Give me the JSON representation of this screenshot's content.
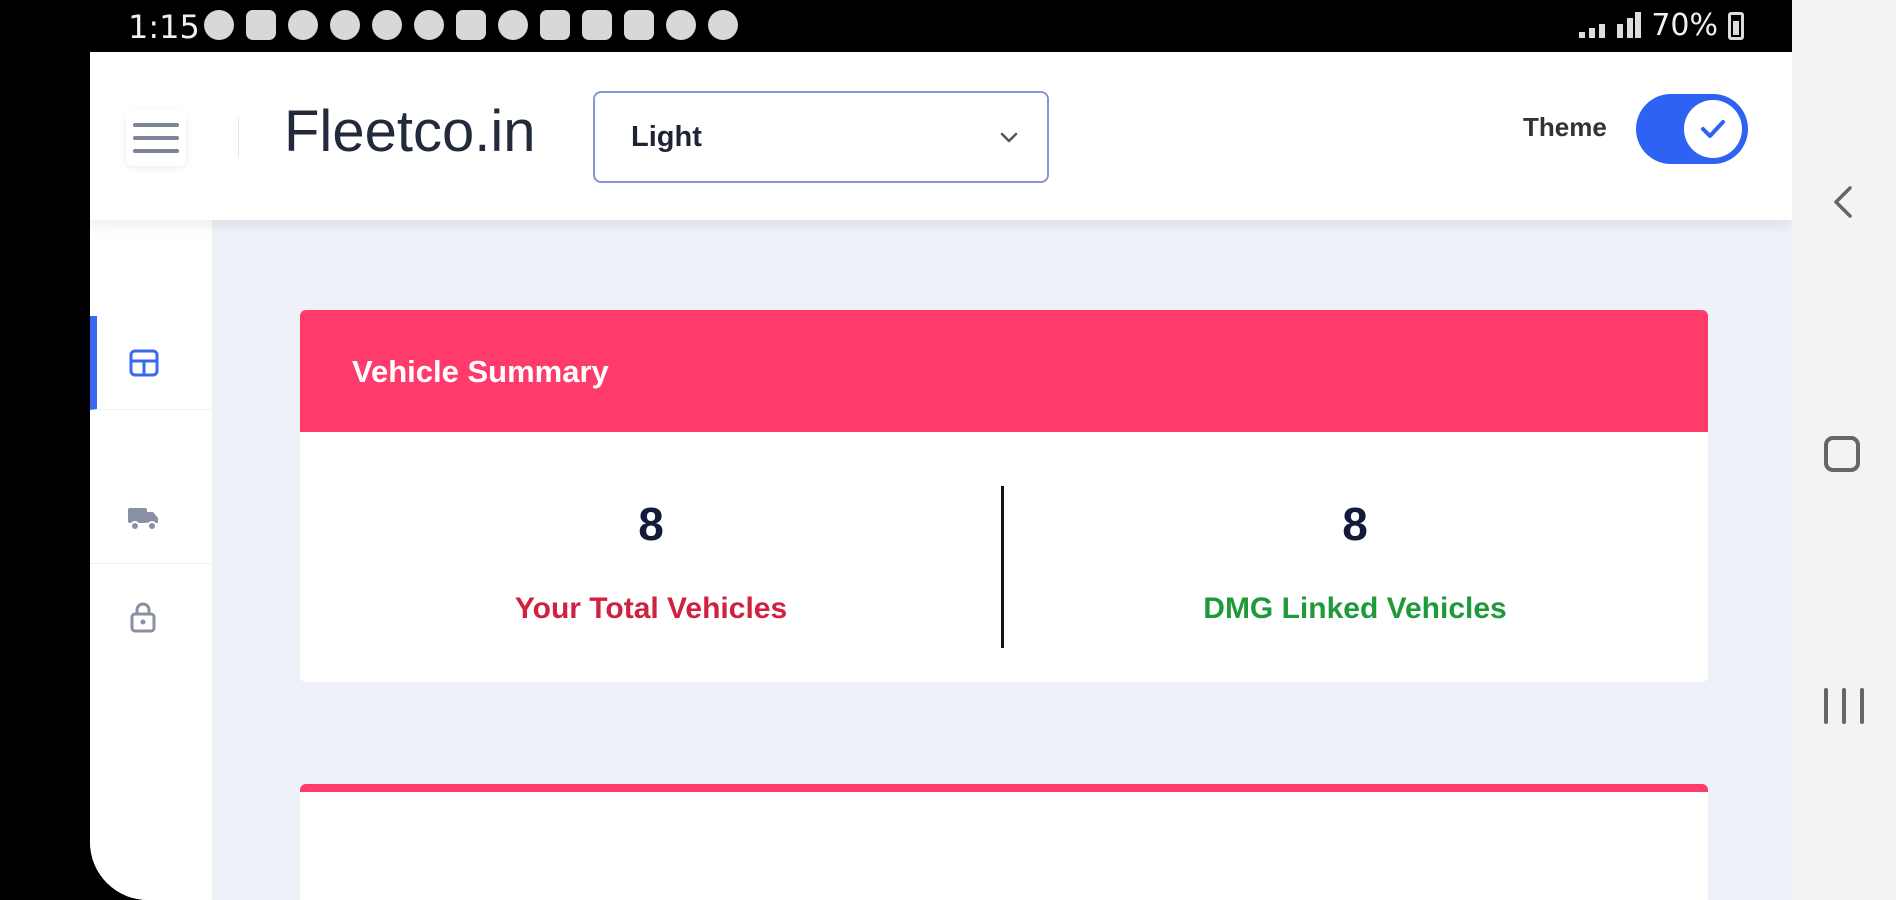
{
  "status_bar": {
    "time": "1:15",
    "battery": "70%",
    "icons": [
      "target-icon",
      "youtube-icon",
      "whatsapp-icon",
      "snapchat-icon",
      "reddit-icon",
      "reddit-icon",
      "instagram-icon",
      "location-icon",
      "mail-icon",
      "instagram-icon",
      "gallery-icon",
      "messages-icon",
      "phone-icon"
    ]
  },
  "app": {
    "brand": "Fleetco.in",
    "theme_select": {
      "value": "Light"
    },
    "theme_label": "Theme",
    "theme_toggle_on": true,
    "accent_color": "#2e62f3"
  },
  "sidebar": {
    "items": [
      {
        "icon": "dashboard-icon",
        "active": true
      },
      {
        "icon": "truck-icon",
        "active": false
      },
      {
        "icon": "lock-icon",
        "active": false
      }
    ]
  },
  "vehicle_summary": {
    "title": "Vehicle Summary",
    "header_color": "#ff3b6b",
    "stats": [
      {
        "value": "8",
        "label": "Your Total Vehicles",
        "color": "#d0213f"
      },
      {
        "value": "8",
        "label": "DMG Linked Vehicles",
        "color": "#1e9a3a"
      }
    ]
  }
}
